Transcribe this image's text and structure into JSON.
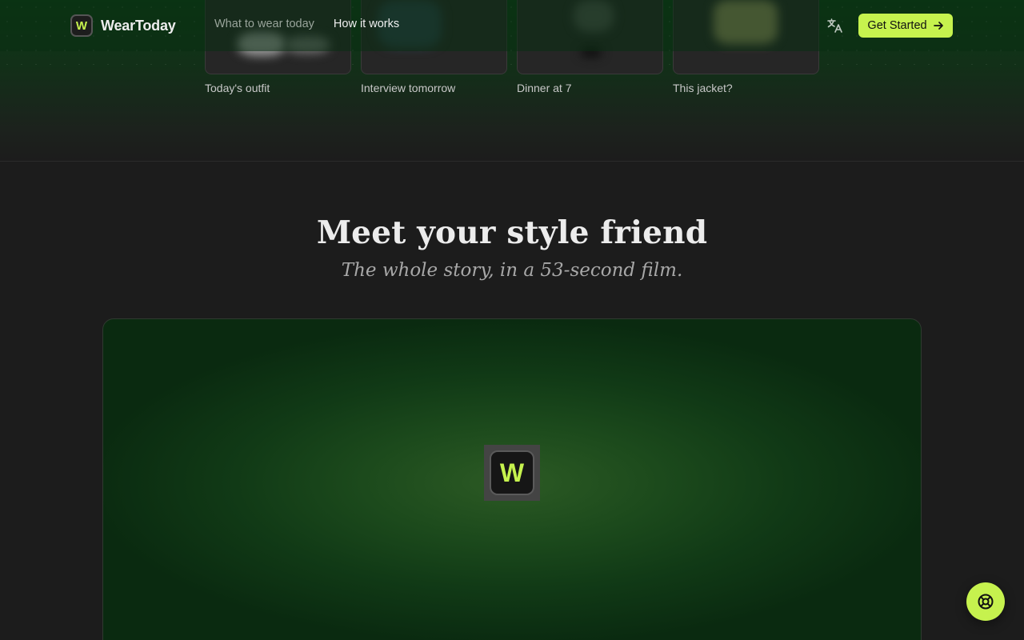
{
  "header": {
    "brand_mark": "W",
    "brand_name": "WearToday",
    "nav": [
      {
        "label": "What to wear today"
      },
      {
        "label": "How it works"
      }
    ],
    "translate_icon": "translate-icon",
    "cta_label": "Get Started",
    "cta_icon": "arrow-right-icon"
  },
  "cards": [
    {
      "caption": "Today's outfit"
    },
    {
      "caption": "Interview tomorrow"
    },
    {
      "caption": "Dinner at 7"
    },
    {
      "caption": "This jacket?"
    }
  ],
  "section": {
    "title": "Meet your style friend",
    "subtitle": "The whole story, in a 53-second film."
  },
  "video": {
    "logo_letter": "W"
  },
  "help_fab_icon": "lifebuoy-icon",
  "colors": {
    "accent": "#c6f24e",
    "background": "#1c1c1c",
    "header_green": "#0d3a15"
  }
}
